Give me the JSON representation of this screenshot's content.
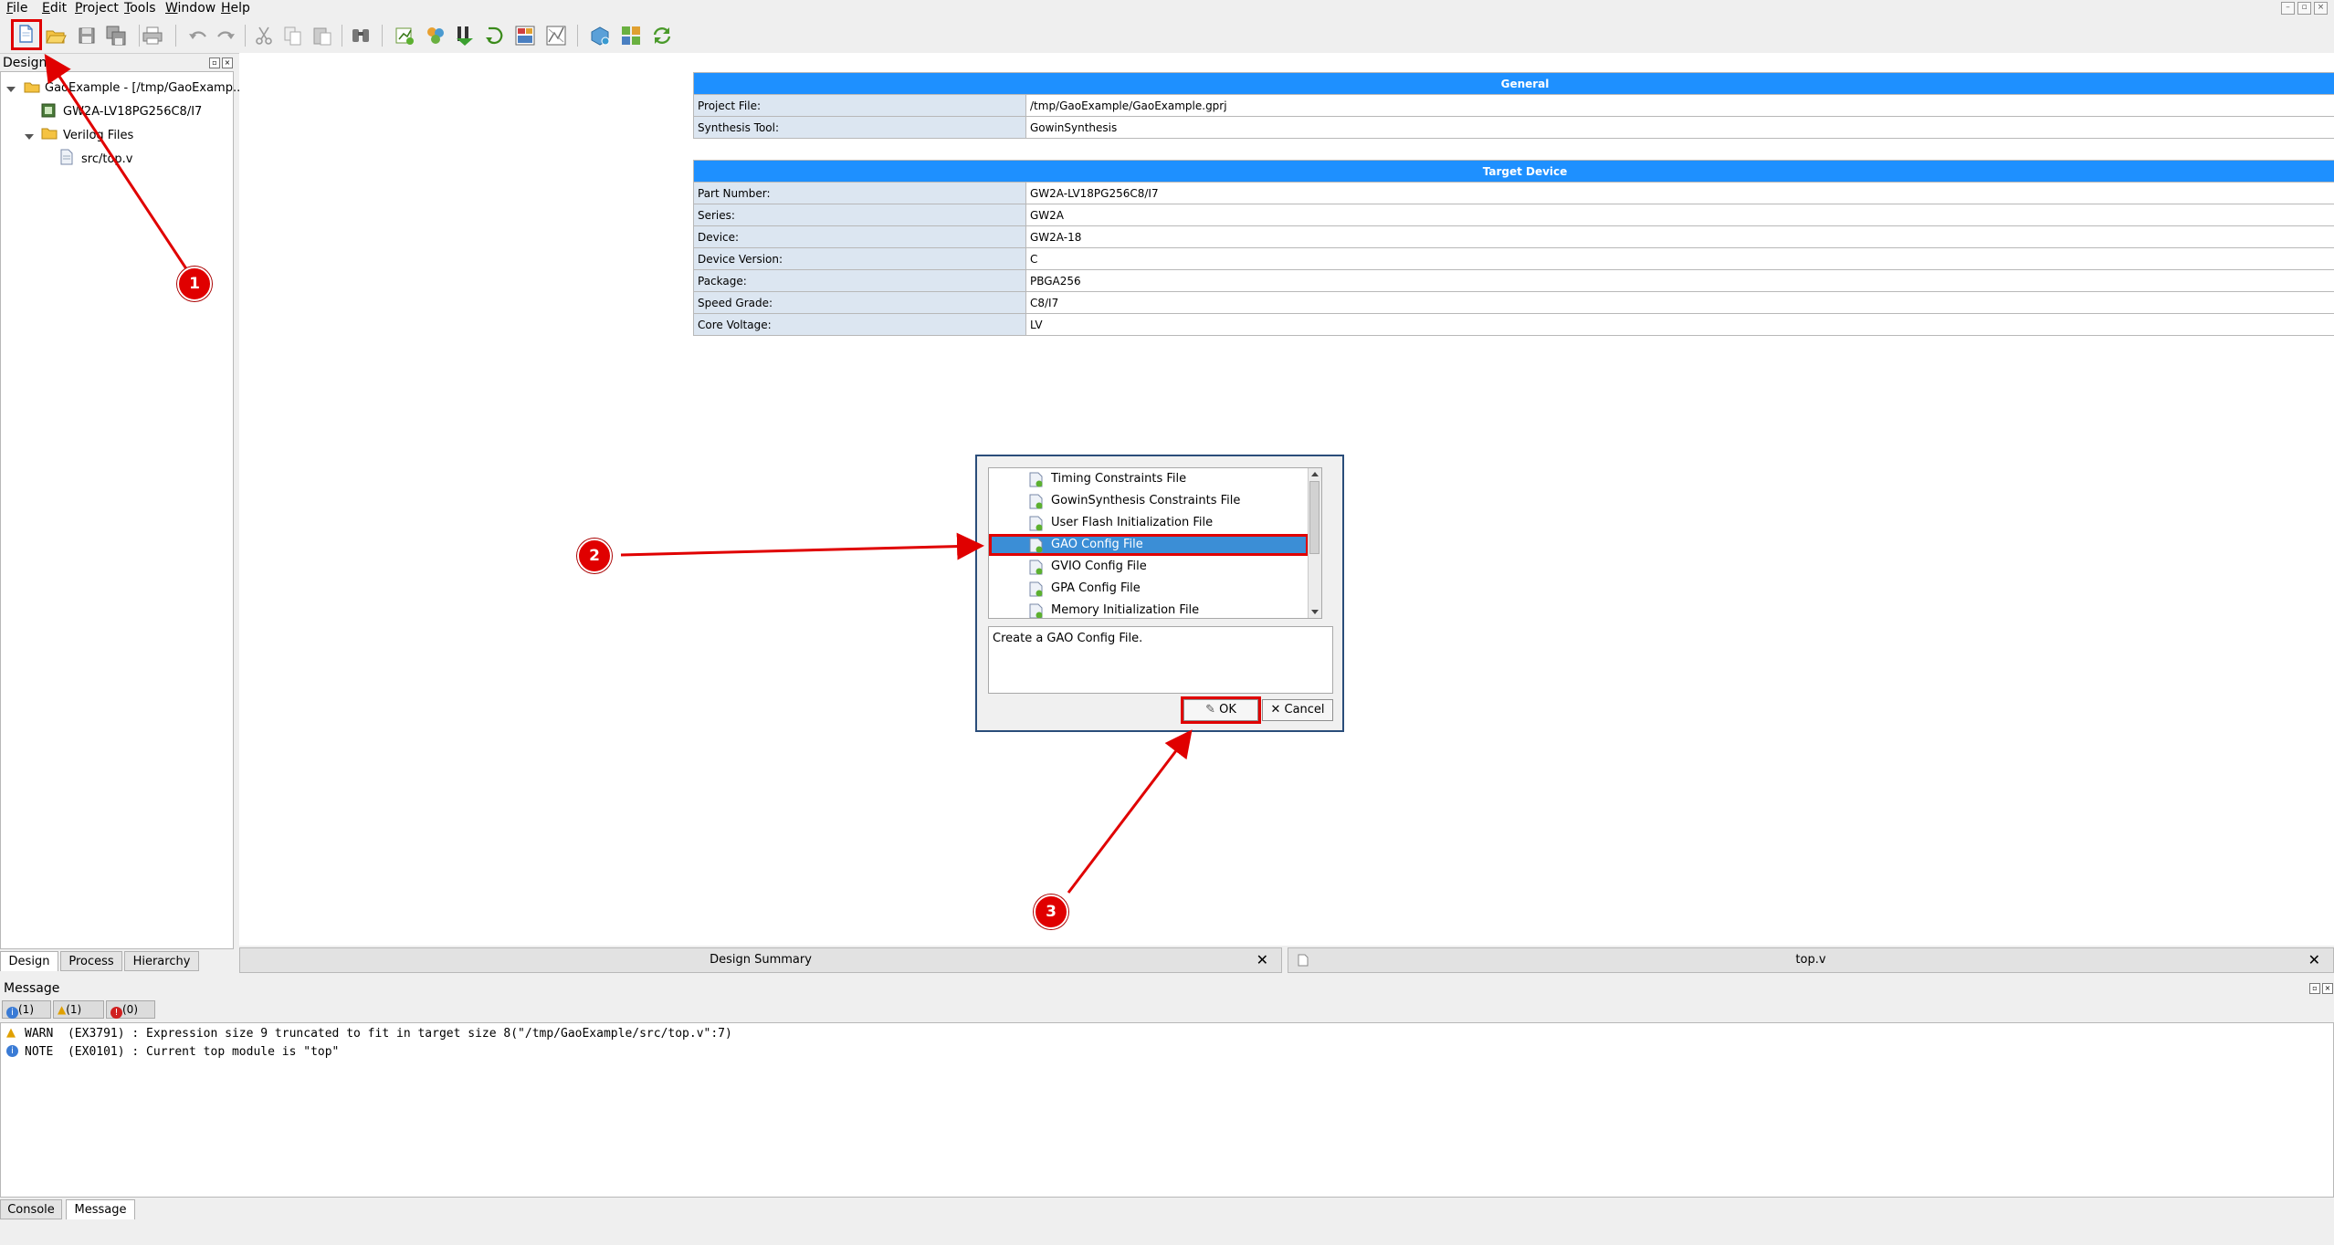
{
  "menu": [
    "File",
    "Edit",
    "Project",
    "Tools",
    "Window",
    "Help"
  ],
  "toolbar_icons": [
    "new-file-icon",
    "open-icon",
    "save-icon",
    "save-all-icon",
    "print-icon",
    "undo-icon",
    "redo-icon",
    "cut-icon",
    "copy-icon",
    "paste-icon",
    "find-icon",
    "synthesize-icon",
    "place-route-icon",
    "program-device-icon",
    "run-all-icon",
    "floor-planner-icon",
    "timing-analyzer-icon",
    "ip-core-icon",
    "gao-icon",
    "refresh-icon"
  ],
  "left_panel": {
    "title": "Design",
    "tree": {
      "project": "GaoExample - [/tmp/GaoExamp...",
      "device": "GW2A-LV18PG256C8/I7",
      "folder": "Verilog Files",
      "file": "src/top.v"
    },
    "tabs": [
      "Design",
      "Process",
      "Hierarchy"
    ]
  },
  "general": {
    "header": "General",
    "rows": [
      {
        "k": "Project File:",
        "v": "/tmp/GaoExample/GaoExample.gprj"
      },
      {
        "k": "Synthesis Tool:",
        "v": "GowinSynthesis"
      }
    ]
  },
  "target": {
    "header": "Target Device",
    "rows": [
      {
        "k": "Part Number:",
        "v": "GW2A-LV18PG256C8/I7"
      },
      {
        "k": "Series:",
        "v": "GW2A"
      },
      {
        "k": "Device:",
        "v": "GW2A-18"
      },
      {
        "k": "Device Version:",
        "v": "C"
      },
      {
        "k": "Package:",
        "v": "PBGA256"
      },
      {
        "k": "Speed Grade:",
        "v": "C8/I7"
      },
      {
        "k": "Core Voltage:",
        "v": "LV"
      }
    ]
  },
  "doc_tabs": [
    {
      "label": "Design Summary"
    },
    {
      "label": "top.v"
    }
  ],
  "dialog": {
    "items": [
      "Timing Constraints File",
      "GowinSynthesis Constraints File",
      "User Flash Initialization File",
      "GAO Config File",
      "GVIO Config File",
      "GPA Config File",
      "Memory Initialization File"
    ],
    "selected_index": 3,
    "description": "Create a GAO Config File.",
    "ok": "OK",
    "cancel": "Cancel"
  },
  "messages": {
    "title": "Message",
    "filters": [
      "(1)",
      "(1)",
      "(0)"
    ],
    "lines": [
      {
        "level": "warn",
        "text": "WARN  (EX3791) : Expression size 9 truncated to fit in target size 8(\"/tmp/GaoExample/src/top.v\":7)"
      },
      {
        "level": "note",
        "text": "NOTE  (EX0101) : Current top module is \"top\""
      }
    ]
  },
  "bottom_tabs": [
    "Console",
    "Message"
  ],
  "annotations": [
    "1",
    "2",
    "3"
  ],
  "colors": {
    "accent": "#1e90ff",
    "annotation": "#e00000",
    "selection": "#3b8ed6"
  }
}
